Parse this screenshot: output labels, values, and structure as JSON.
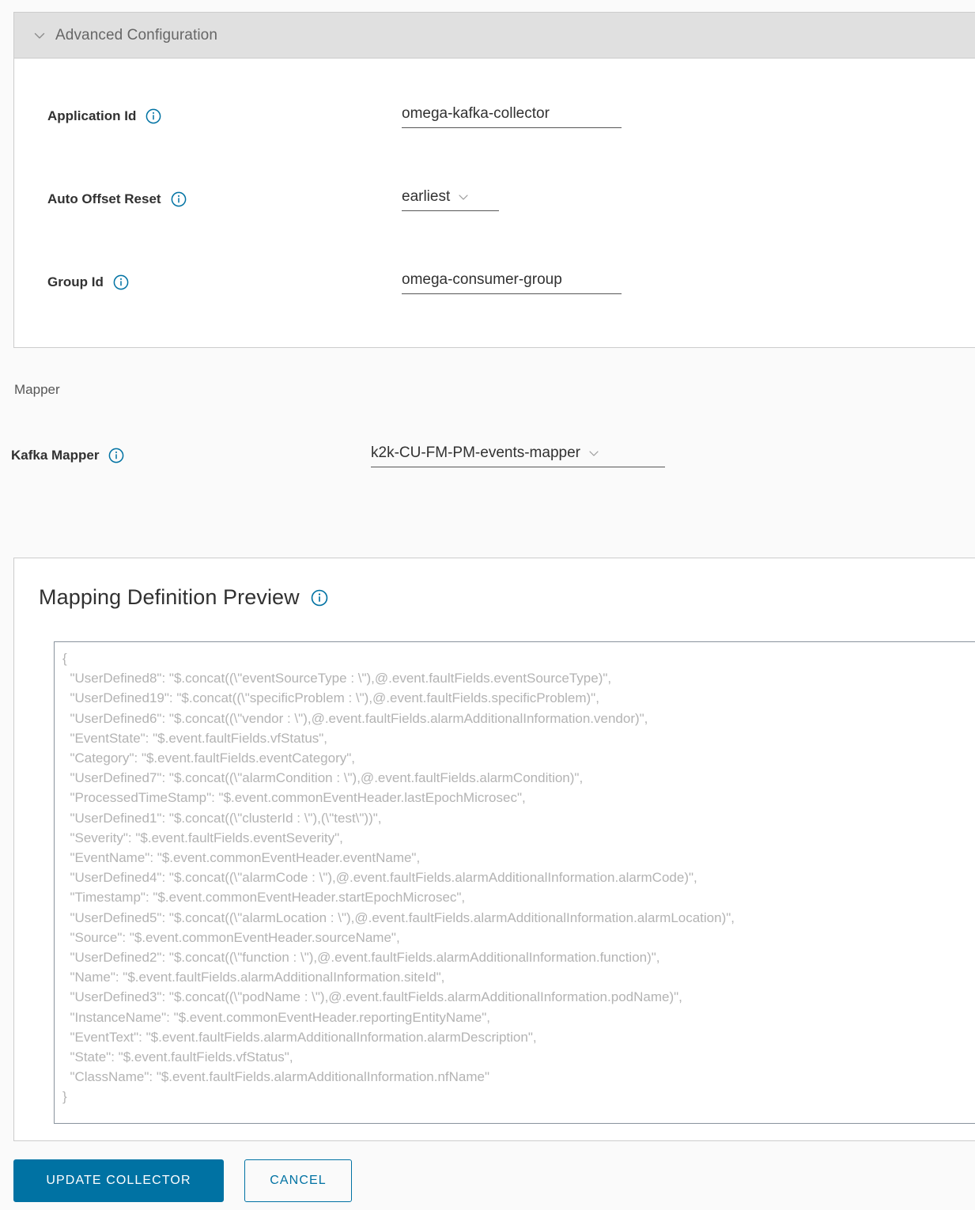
{
  "advanced_section": {
    "title": "Advanced Configuration",
    "expanded": true,
    "chevron_icon": "chevron-down-icon",
    "fields": [
      {
        "label": "Application Id",
        "info_icon": "info-circle-icon",
        "type": "text",
        "value": "omega-kafka-collector"
      },
      {
        "label": "Auto Offset Reset",
        "info_icon": "info-circle-icon",
        "type": "select",
        "value": "earliest",
        "caret_icon": "chevron-down-icon"
      },
      {
        "label": "Group Id",
        "info_icon": "info-circle-icon",
        "type": "text",
        "value": "omega-consumer-group"
      }
    ]
  },
  "mapper_section": {
    "section_label": "Mapper",
    "field": {
      "label": "Kafka Mapper",
      "info_icon": "info-circle-icon",
      "type": "select",
      "value": "k2k-CU-FM-PM-events-mapper",
      "caret_icon": "chevron-down-icon"
    }
  },
  "mapping_preview": {
    "title": "Mapping Definition Preview",
    "info_icon": "info-circle-icon",
    "readonly": true,
    "content": "{\n  \"UserDefined8\": \"$.concat((\\\"eventSourceType : \\\"),@.event.faultFields.eventSourceType)\",\n  \"UserDefined19\": \"$.concat((\\\"specificProblem : \\\"),@.event.faultFields.specificProblem)\",\n  \"UserDefined6\": \"$.concat((\\\"vendor : \\\"),@.event.faultFields.alarmAdditionalInformation.vendor)\",\n  \"EventState\": \"$.event.faultFields.vfStatus\",\n  \"Category\": \"$.event.faultFields.eventCategory\",\n  \"UserDefined7\": \"$.concat((\\\"alarmCondition : \\\"),@.event.faultFields.alarmCondition)\",\n  \"ProcessedTimeStamp\": \"$.event.commonEventHeader.lastEpochMicrosec\",\n  \"UserDefined1\": \"$.concat((\\\"clusterId : \\\"),(\\\"test\\\"))\",\n  \"Severity\": \"$.event.faultFields.eventSeverity\",\n  \"EventName\": \"$.event.commonEventHeader.eventName\",\n  \"UserDefined4\": \"$.concat((\\\"alarmCode : \\\"),@.event.faultFields.alarmAdditionalInformation.alarmCode)\",\n  \"Timestamp\": \"$.event.commonEventHeader.startEpochMicrosec\",\n  \"UserDefined5\": \"$.concat((\\\"alarmLocation : \\\"),@.event.faultFields.alarmAdditionalInformation.alarmLocation)\",\n  \"Source\": \"$.event.commonEventHeader.sourceName\",\n  \"UserDefined2\": \"$.concat((\\\"function : \\\"),@.event.faultFields.alarmAdditionalInformation.function)\",\n  \"Name\": \"$.event.faultFields.alarmAdditionalInformation.siteId\",\n  \"UserDefined3\": \"$.concat((\\\"podName : \\\"),@.event.faultFields.alarmAdditionalInformation.podName)\",\n  \"InstanceName\": \"$.event.commonEventHeader.reportingEntityName\",\n  \"EventText\": \"$.event.faultFields.alarmAdditionalInformation.alarmDescription\",\n  \"State\": \"$.event.faultFields.vfStatus\",\n  \"ClassName\": \"$.event.faultFields.alarmAdditionalInformation.nfName\"\n}"
  },
  "footer": {
    "primary_label": "Update Collector",
    "secondary_label": "Cancel"
  },
  "colors": {
    "accent": "#0072a3",
    "header_bg": "#e0e0e0",
    "page_bg": "#fafafa",
    "text": "#313131",
    "muted_text": "#666666",
    "code_text": "#b3b3b3",
    "border": "#cccccc",
    "input_underline": "#565656"
  }
}
